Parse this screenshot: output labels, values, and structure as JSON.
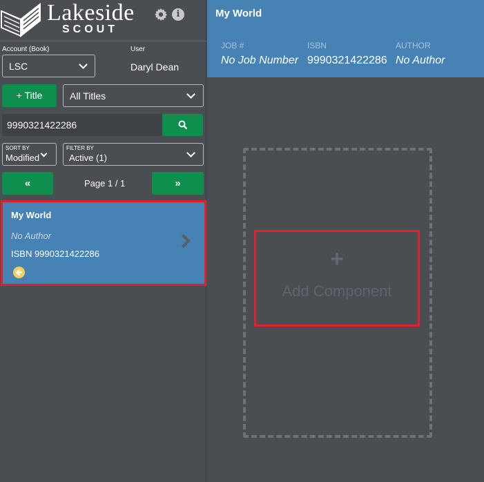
{
  "app": {
    "logo_text": "Lakeside",
    "logo_sub": "SCOUT"
  },
  "sidebar": {
    "account_label": "Account (Book)",
    "account_value": "LSC",
    "user_label": "User",
    "user_value": "Daryl Dean",
    "add_title_label": "+ Title",
    "titles_filter_value": "All Titles",
    "search_value": "9990321422286",
    "sort_label": "SORT BY",
    "sort_value": "Modified",
    "filter_label": "FILTER BY",
    "filter_value": "Active (1)",
    "prev_label": "«",
    "next_label": "»",
    "page_label": "Page 1 / 1",
    "card": {
      "title": "My World",
      "author": "No Author",
      "isbn": "ISBN 9990321422286"
    }
  },
  "main": {
    "title": "My World",
    "meta": [
      {
        "label": "JOB #",
        "value": "No Job Number"
      },
      {
        "label": "ISBN",
        "value": "9990321422286"
      },
      {
        "label": "AUTHOR",
        "value": "No Author"
      }
    ],
    "add_component_plus": "+",
    "add_component_label": "Add Component"
  },
  "colors": {
    "background": "#4a4d51",
    "accent_blue": "#4682b4",
    "green": "#0e8f4e",
    "highlight_red": "#e0202a",
    "badge_yellow": "#f4cf5e"
  },
  "icons": [
    "book-logo-icon",
    "gear-icon",
    "info-icon",
    "chevron-down-icon",
    "search-icon",
    "double-chevron-left-icon",
    "double-chevron-right-icon",
    "chevron-right-icon",
    "back-arrow-badge-icon",
    "plus-icon"
  ]
}
